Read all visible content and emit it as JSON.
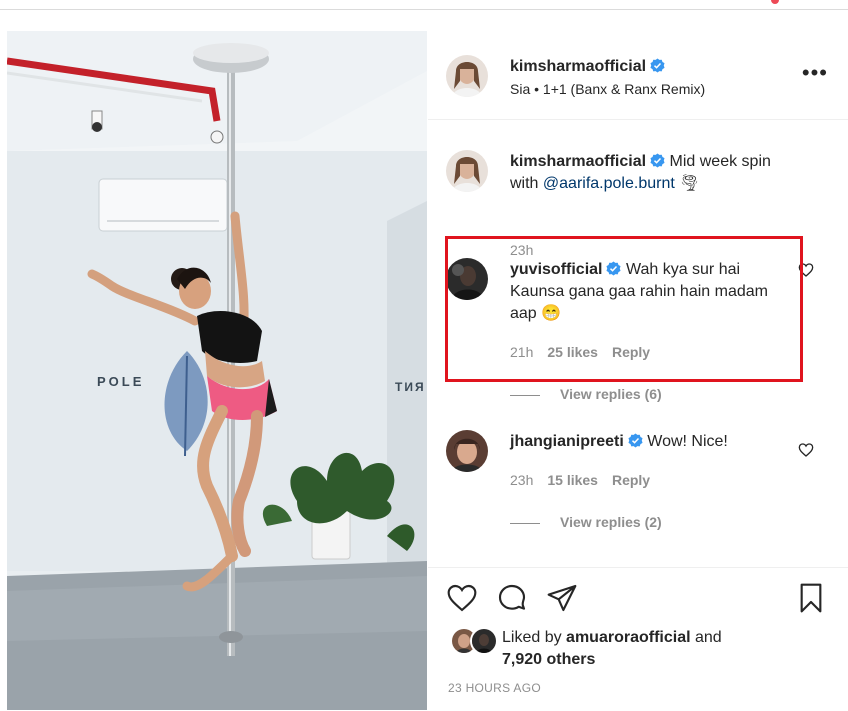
{
  "post": {
    "author": "kimsharmaofficial",
    "audio": "Sia • 1+1 (Banx & Ranx Remix)",
    "more_label": "•••",
    "caption": {
      "user": "kimsharmaofficial",
      "text_before": "Mid week spin with ",
      "mention": "@aarifa.pole.burnt",
      "emoji": "🌪",
      "age": "23h"
    },
    "comments": [
      {
        "user": "yuvisofficial",
        "text": "Wah kya sur hai Kaunsa gana gaa rahin hain madam aap 😁",
        "age": "21h",
        "likes": "25 likes",
        "reply": "Reply",
        "view_replies": "View replies (6)"
      },
      {
        "user": "jhangianipreeti",
        "text": "Wow! Nice!",
        "age": "23h",
        "likes": "15 likes",
        "reply": "Reply",
        "view_replies": "View replies (2)"
      }
    ],
    "liked_by_prefix": "Liked by ",
    "liked_by_user": "amuarora official",
    "liked_by_user_exact": "amuaroraofficial",
    "liked_by_and": " and",
    "liked_by_others": "7,920 others",
    "timestamp": "23 HOURS AGO"
  },
  "image": {
    "wall_text_left": "POLE",
    "wall_text_right": "TИЯ"
  },
  "colors": {
    "verified": "#3897f0",
    "highlight": "#e0141e",
    "mention": "#00376b"
  }
}
